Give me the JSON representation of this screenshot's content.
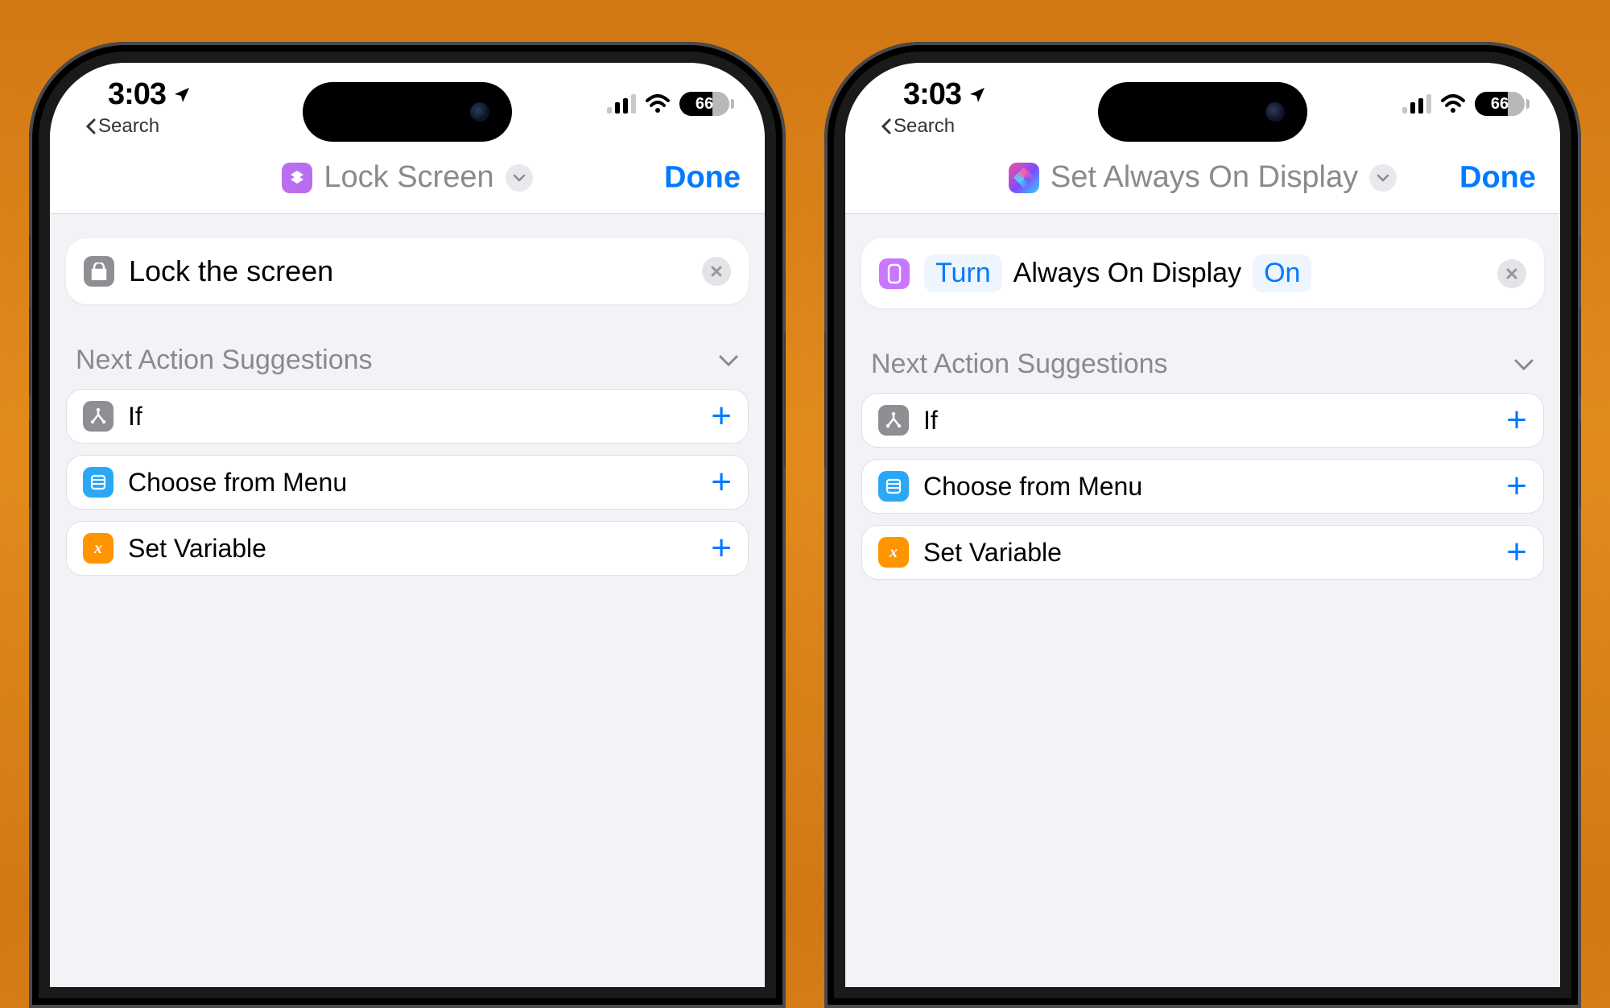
{
  "statusbar": {
    "time": "3:03",
    "back_label": "Search",
    "battery": "66"
  },
  "phones": {
    "left": {
      "nav": {
        "title": "Lock Screen",
        "done": "Done"
      },
      "action": {
        "text": "Lock the screen"
      }
    },
    "right": {
      "nav": {
        "title": "Set Always On Display",
        "done": "Done"
      },
      "action": {
        "turn": "Turn",
        "subject": "Always On Display",
        "state": "On"
      }
    }
  },
  "suggestions": {
    "heading": "Next Action Suggestions",
    "items": [
      {
        "label": "If"
      },
      {
        "label": "Choose from Menu"
      },
      {
        "label": "Set Variable"
      }
    ]
  }
}
